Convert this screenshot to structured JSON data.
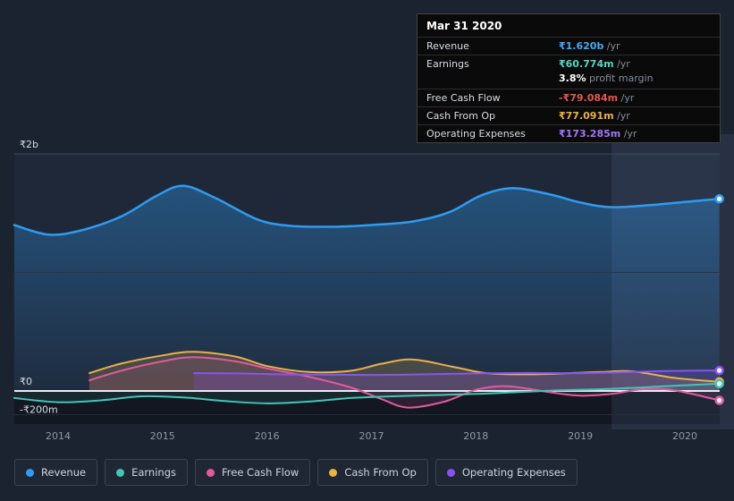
{
  "app": {
    "background": "#1c2330"
  },
  "tooltip": {
    "date": "Mar 31 2020",
    "rows": [
      {
        "label": "Revenue",
        "value": "₹1.620b",
        "suffix": " /yr",
        "color": "#4aa8f5"
      },
      {
        "label": "Earnings",
        "value": "₹60.774m",
        "suffix": " /yr",
        "color": "#57d6c4"
      },
      {
        "label": "",
        "value": "3.8%",
        "suffix": " profit margin",
        "color": "#ffffff"
      },
      {
        "label": "Free Cash Flow",
        "value": "-₹79.084m",
        "suffix": " /yr",
        "color": "#e2574f"
      },
      {
        "label": "Cash From Op",
        "value": "₹77.091m",
        "suffix": " /yr",
        "color": "#e9b04c"
      },
      {
        "label": "Operating Expenses",
        "value": "₹173.285m",
        "suffix": " /yr",
        "color": "#a377f5"
      }
    ]
  },
  "legend": {
    "items": [
      {
        "label": "Revenue",
        "color": "#2f9bf1"
      },
      {
        "label": "Earnings",
        "color": "#45c4b4"
      },
      {
        "label": "Free Cash Flow",
        "color": "#df5c9c"
      },
      {
        "label": "Cash From Op",
        "color": "#e9b04c"
      },
      {
        "label": "Operating Expenses",
        "color": "#8a53f0"
      }
    ]
  },
  "chart_data": {
    "type": "area",
    "title": "",
    "y_unit": "₹m",
    "x_domain": [
      2013.58,
      2020.33
    ],
    "x_ticks": [
      "2014",
      "2015",
      "2016",
      "2017",
      "2018",
      "2019",
      "2020"
    ],
    "x_tick_years": [
      2014,
      2015,
      2016,
      2017,
      2018,
      2019,
      2020
    ],
    "y_gridlines": [
      {
        "value": 2000,
        "label": "₹2b"
      },
      {
        "value": 1000,
        "label": ""
      },
      {
        "value": 0,
        "label": "₹0"
      },
      {
        "value": -200,
        "label": "-₹200m"
      }
    ],
    "highlight_from_year": 2019.3,
    "series": [
      {
        "name": "Revenue",
        "color": "#2f9bf1",
        "line_width": 2.5,
        "area_gradient": true,
        "fill": "",
        "x": [
          2013.58,
          2013.9,
          2014.2,
          2014.6,
          2014.95,
          2015.2,
          2015.5,
          2015.9,
          2016.2,
          2016.6,
          2017.0,
          2017.4,
          2017.75,
          2018.05,
          2018.35,
          2018.7,
          2019.0,
          2019.3,
          2019.7,
          2020.0,
          2020.33
        ],
        "values": [
          1400,
          1320,
          1350,
          1470,
          1650,
          1730,
          1630,
          1450,
          1395,
          1385,
          1400,
          1430,
          1510,
          1650,
          1710,
          1660,
          1590,
          1550,
          1570,
          1595,
          1620
        ]
      },
      {
        "name": "Cash From Op",
        "color": "#e9b04c",
        "line_width": 2,
        "area_gradient": false,
        "fill": "rgba(233,176,76,0.20)",
        "x": [
          2014.3,
          2014.6,
          2015.0,
          2015.3,
          2015.7,
          2016.0,
          2016.4,
          2016.8,
          2017.1,
          2017.4,
          2017.8,
          2018.1,
          2018.5,
          2018.9,
          2019.2,
          2019.5,
          2019.9,
          2020.33
        ],
        "values": [
          150,
          230,
          300,
          330,
          290,
          210,
          160,
          170,
          230,
          265,
          200,
          150,
          140,
          150,
          160,
          165,
          110,
          77
        ]
      },
      {
        "name": "Free Cash Flow",
        "color": "#df5c9c",
        "line_width": 2,
        "area_gradient": false,
        "fill": "rgba(223,92,156,0.14)",
        "x": [
          2014.3,
          2014.6,
          2015.0,
          2015.3,
          2015.7,
          2016.0,
          2016.4,
          2016.8,
          2017.1,
          2017.35,
          2017.7,
          2018.0,
          2018.3,
          2018.7,
          2019.0,
          2019.3,
          2019.6,
          2019.9,
          2020.33
        ],
        "values": [
          90,
          170,
          250,
          285,
          250,
          190,
          120,
          30,
          -70,
          -140,
          -90,
          10,
          40,
          -10,
          -40,
          -25,
          15,
          5,
          -79
        ]
      },
      {
        "name": "Operating Expenses",
        "color": "#8a53f0",
        "line_width": 2,
        "area_gradient": false,
        "fill": "rgba(138,83,240,0.22)",
        "x": [
          2015.3,
          2015.7,
          2016.1,
          2016.5,
          2017.0,
          2017.5,
          2018.0,
          2018.5,
          2019.0,
          2019.4,
          2019.8,
          2020.33
        ],
        "values": [
          150,
          148,
          140,
          138,
          135,
          140,
          148,
          152,
          150,
          158,
          168,
          173
        ]
      },
      {
        "name": "Earnings",
        "color": "#45c4b4",
        "line_width": 2,
        "area_gradient": false,
        "fill": "rgba(69,196,180,0.10)",
        "x": [
          2013.58,
          2014.0,
          2014.4,
          2014.8,
          2015.2,
          2015.6,
          2016.0,
          2016.4,
          2016.8,
          2017.2,
          2017.6,
          2018.0,
          2018.4,
          2018.8,
          2019.2,
          2019.6,
          2020.0,
          2020.33
        ],
        "values": [
          -60,
          -95,
          -80,
          -45,
          -55,
          -85,
          -105,
          -90,
          -60,
          -45,
          -35,
          -25,
          -10,
          5,
          15,
          30,
          48,
          61
        ]
      }
    ]
  }
}
